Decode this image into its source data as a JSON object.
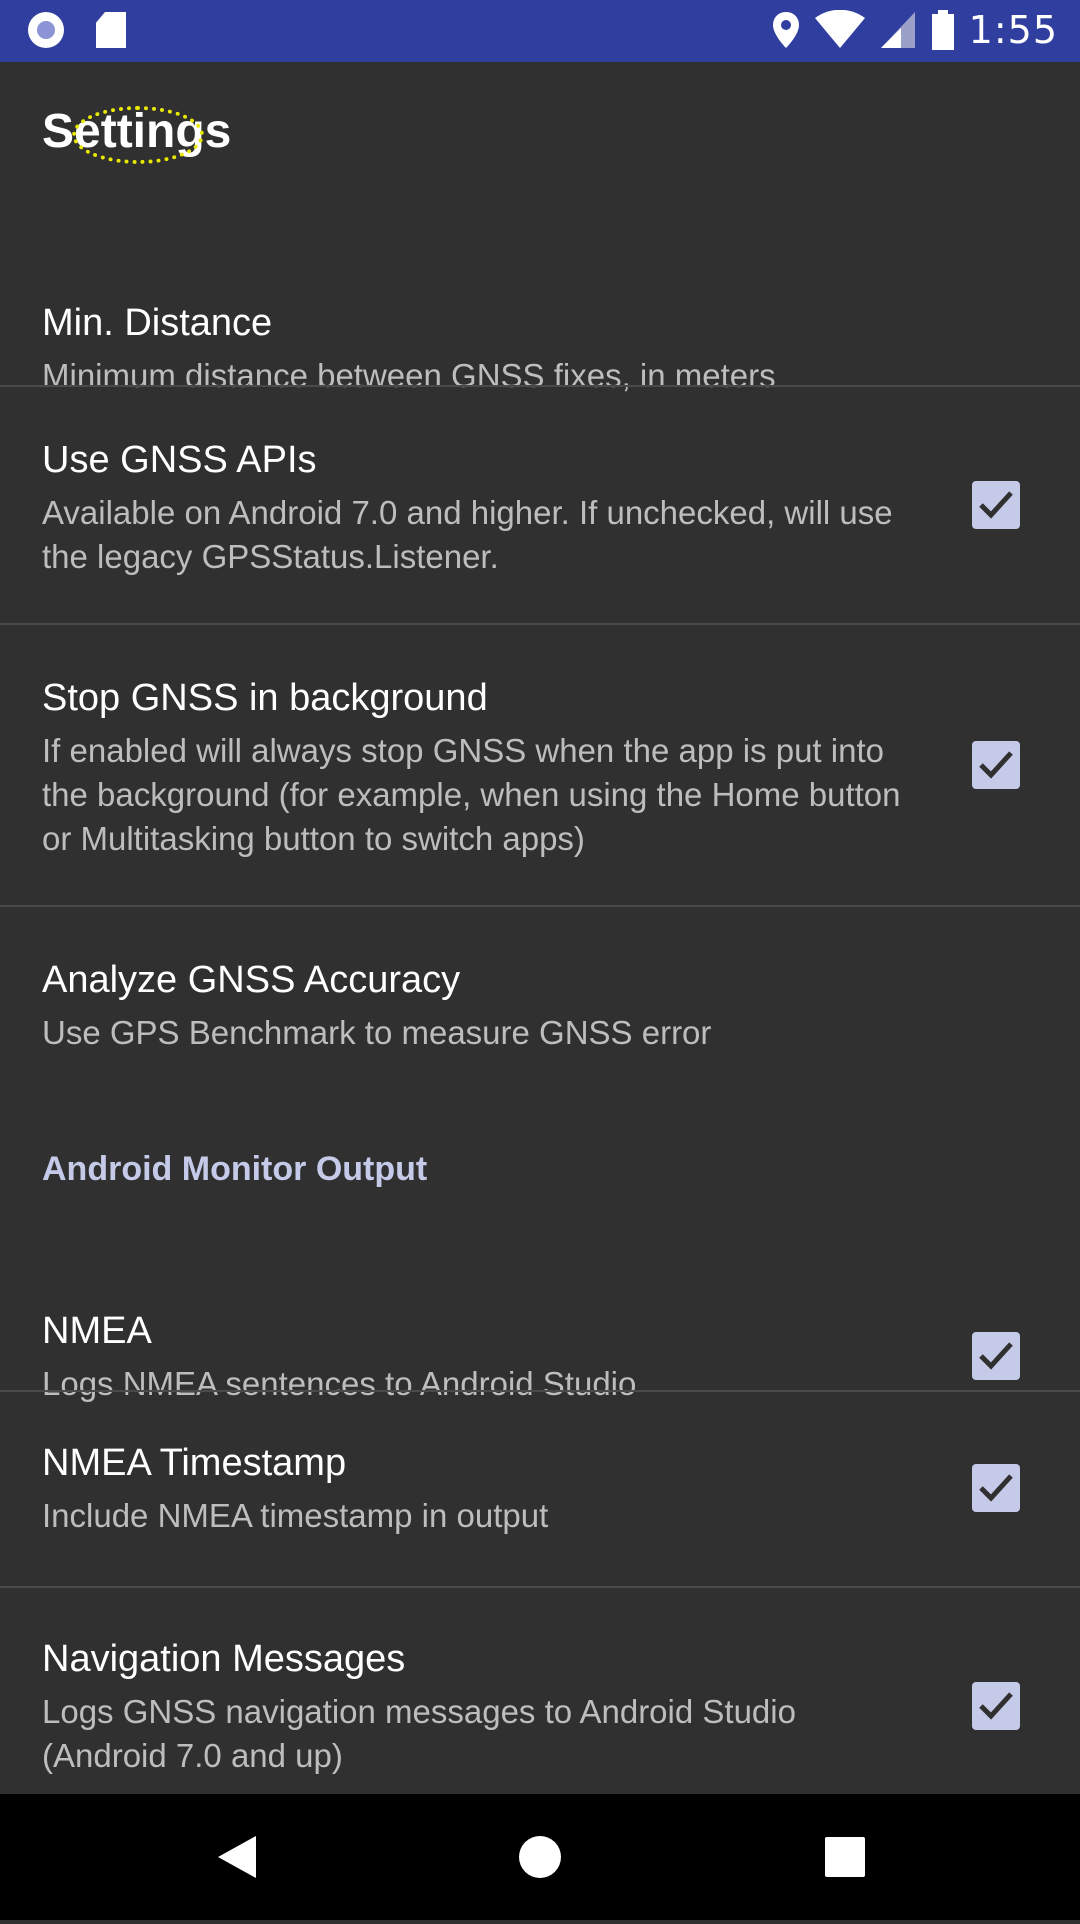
{
  "status_bar": {
    "time": "1:55",
    "icons": [
      "app-circle-icon",
      "sd-card-icon",
      "location-icon",
      "wifi-icon",
      "signal-icon",
      "battery-icon"
    ]
  },
  "screen": {
    "title": "Settings"
  },
  "preferences": [
    {
      "title": "Min. Distance",
      "summary": "Minimum distance between GNSS fixes, in meters",
      "checkbox": false
    },
    {
      "title": "Use GNSS APIs",
      "summary": "Available on Android 7.0 and higher. If unchecked, will use the legacy GPSStatus.Listener.",
      "checkbox": true,
      "checked": true
    },
    {
      "title": "Stop GNSS in background",
      "summary": "If enabled will always stop GNSS when the app is put into the background (for example, when using the Home button or Multitasking button to switch apps)",
      "checkbox": true,
      "checked": true
    },
    {
      "title": "Analyze GNSS Accuracy",
      "summary": "Use GPS Benchmark to measure GNSS error",
      "checkbox": false
    }
  ],
  "category": {
    "label": "Android Monitor Output"
  },
  "monitor_preferences": [
    {
      "title": "NMEA",
      "summary": "Logs NMEA sentences to Android Studio",
      "checked": true
    },
    {
      "title": "NMEA Timestamp",
      "summary": "Include NMEA timestamp in output",
      "checked": true
    },
    {
      "title": "Navigation Messages",
      "summary": "Logs GNSS navigation messages to Android Studio (Android 7.0 and up)",
      "checked": true
    }
  ],
  "colors": {
    "status_bar": "#303f9f",
    "background": "#303030",
    "accent": "#c5cae9"
  },
  "nav_bar": {
    "icons": [
      "back-icon",
      "home-icon",
      "recents-icon"
    ]
  }
}
